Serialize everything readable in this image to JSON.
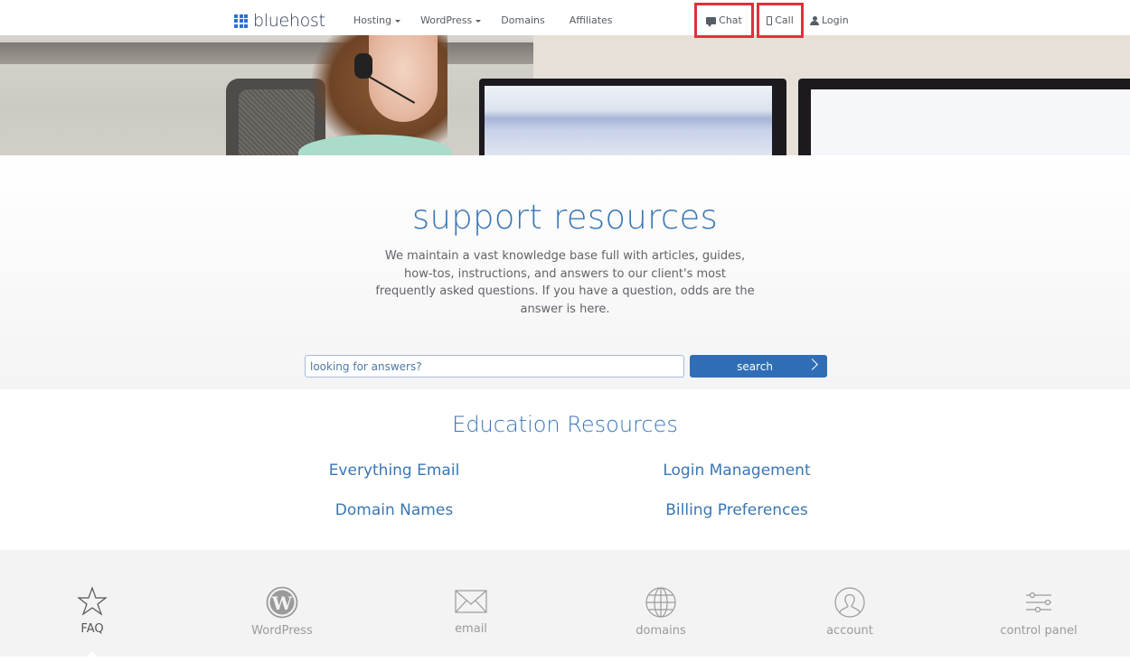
{
  "header": {
    "logo_text": "bluehost",
    "nav": [
      {
        "label": "Hosting",
        "has_dropdown": true
      },
      {
        "label": "WordPress",
        "has_dropdown": true
      },
      {
        "label": "Domains",
        "has_dropdown": false
      },
      {
        "label": "Affiliates",
        "has_dropdown": false
      }
    ],
    "utility": {
      "chat_label": "Chat",
      "call_label": "Call",
      "login_label": "Login"
    },
    "highlight_color": "#e0303d"
  },
  "hero": {
    "image_description": "Smiling support agent wearing a headset in front of computer monitors"
  },
  "support": {
    "title": "support resources",
    "description": "We maintain a vast knowledge base full with articles, guides, how-tos, instructions, and answers to our client's most frequently asked questions. If you have a question, odds are the answer is here.",
    "search_placeholder": "looking for answers?",
    "search_value": "",
    "search_button_label": "search"
  },
  "education": {
    "title": "Education Resources",
    "links": [
      {
        "label": "Everything Email"
      },
      {
        "label": "Login Management"
      },
      {
        "label": "Domain Names"
      },
      {
        "label": "Billing Preferences"
      }
    ]
  },
  "categories": [
    {
      "label": "FAQ",
      "icon": "star-icon",
      "active": true
    },
    {
      "label": "WordPress",
      "icon": "wordpress-icon",
      "active": false
    },
    {
      "label": "email",
      "icon": "envelope-icon",
      "active": false
    },
    {
      "label": "domains",
      "icon": "globe-icon",
      "active": false
    },
    {
      "label": "account",
      "icon": "user-circle-icon",
      "active": false
    },
    {
      "label": "control panel",
      "icon": "sliders-icon",
      "active": false
    }
  ],
  "colors": {
    "brand_blue": "#2f6ed6",
    "link_blue": "#3a76b4",
    "button_blue": "#2f6eb6"
  }
}
